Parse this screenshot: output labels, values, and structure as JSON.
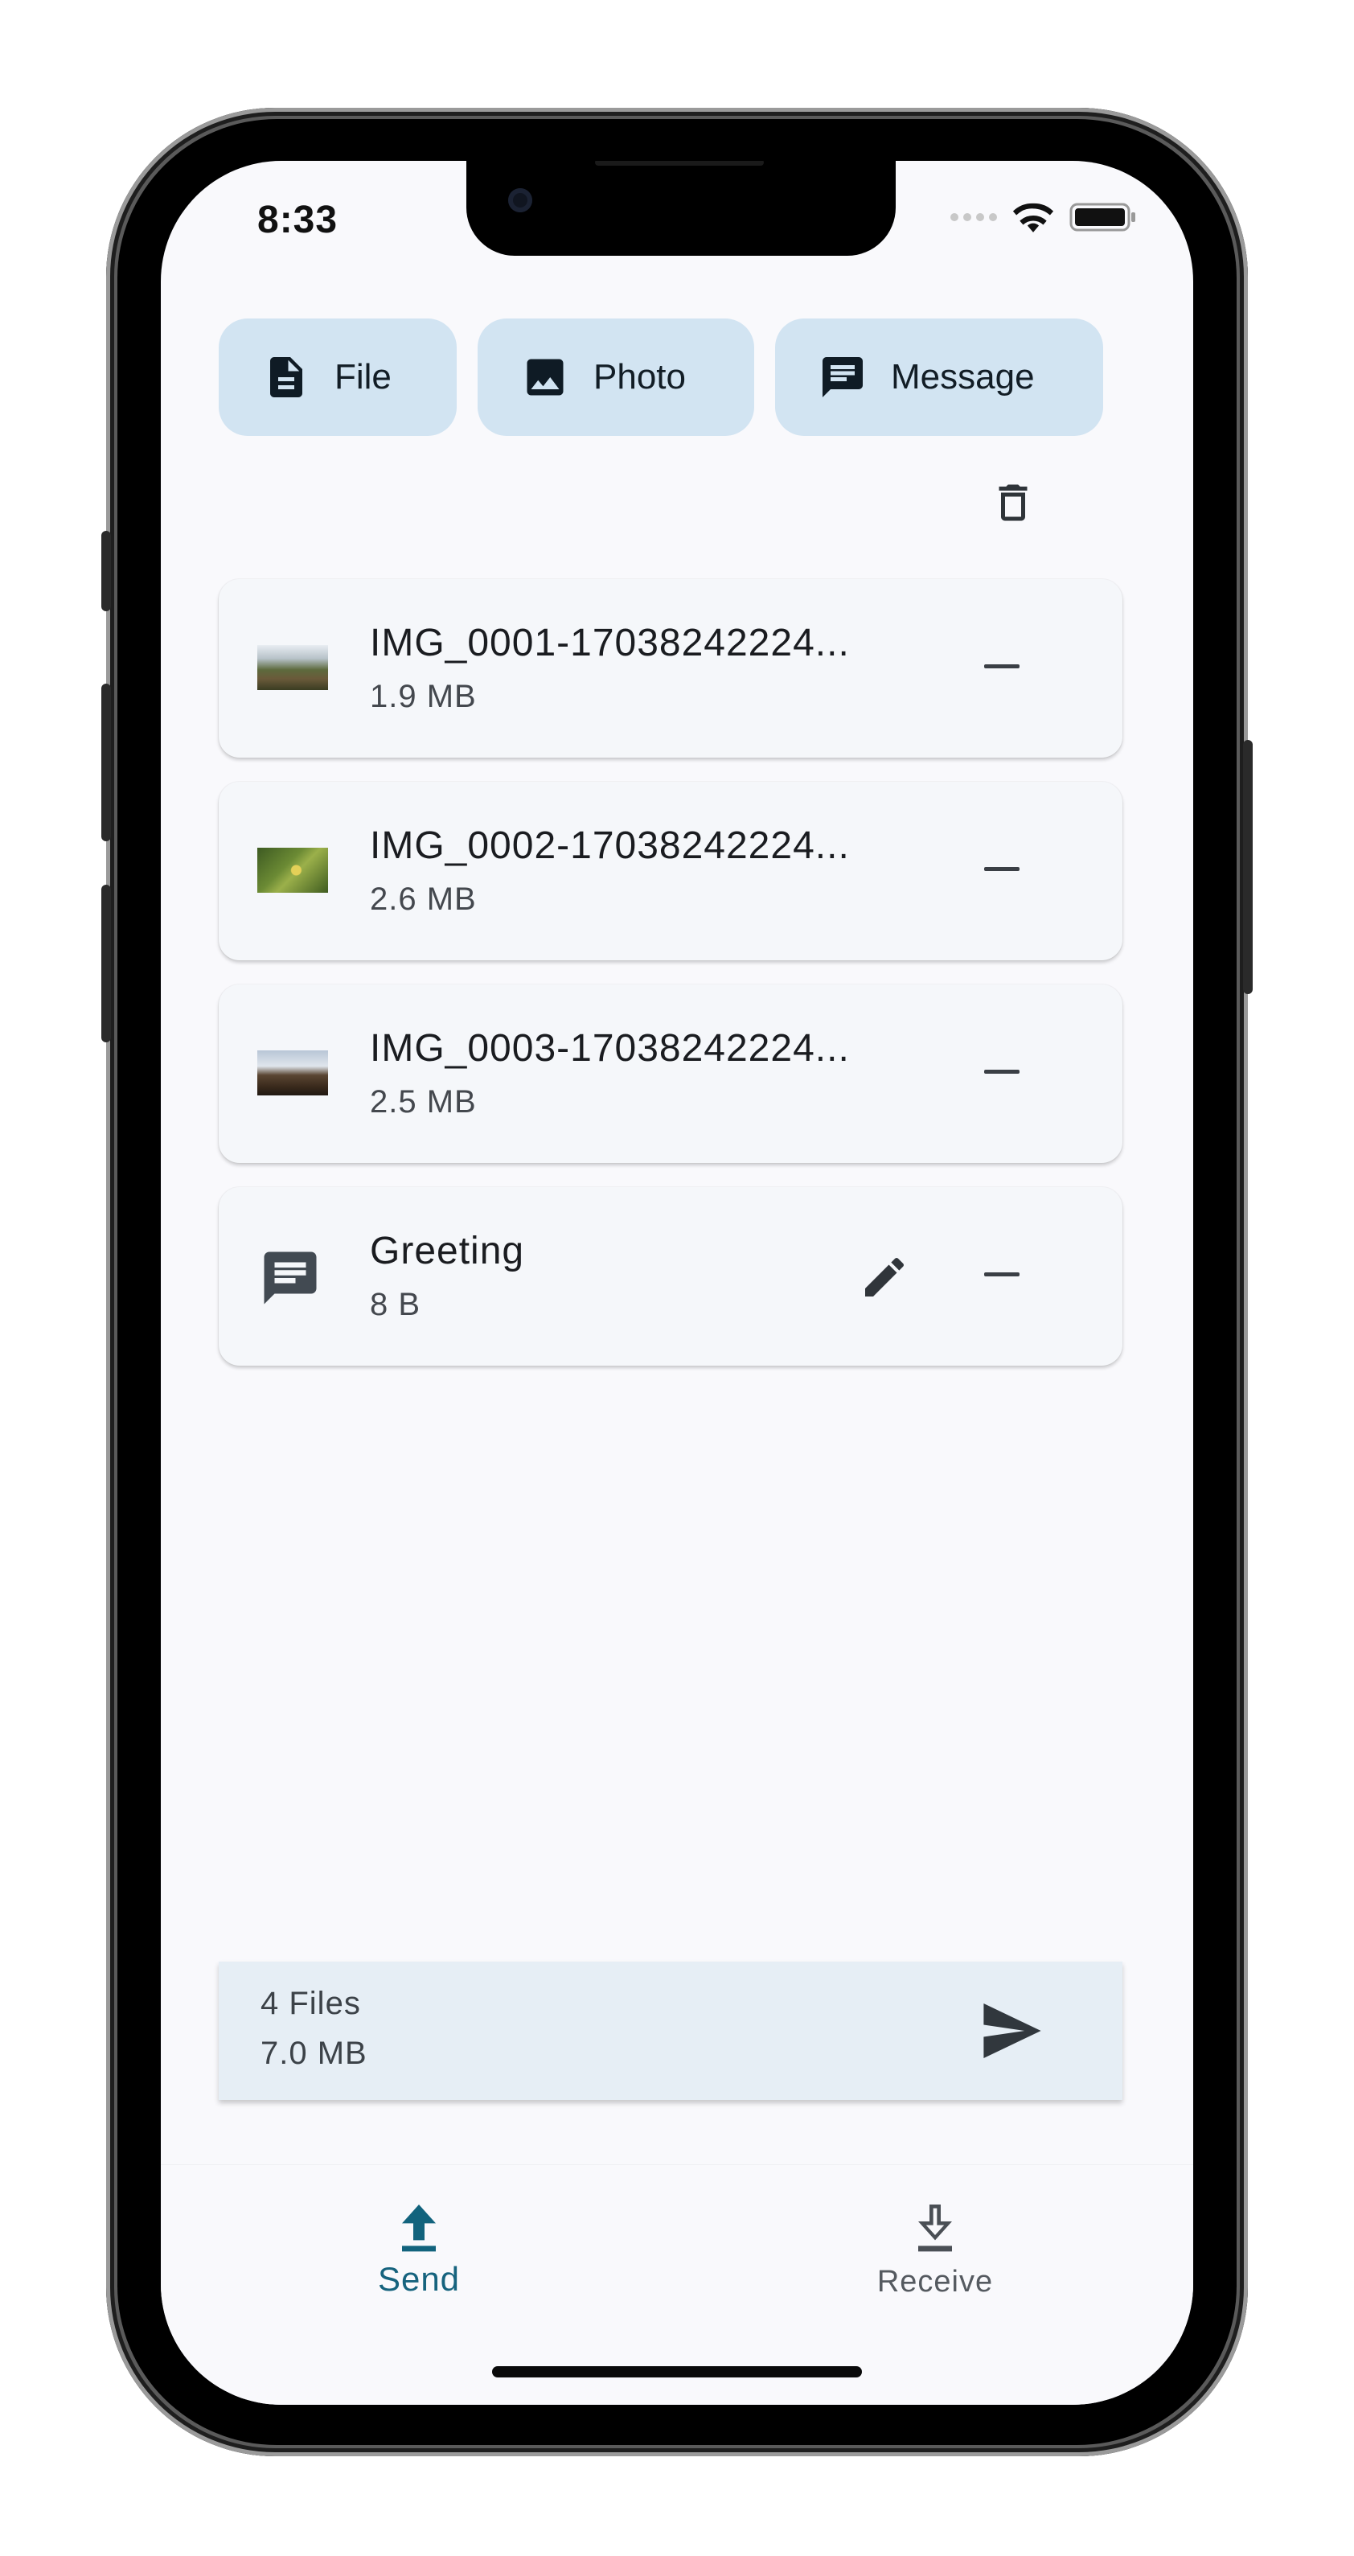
{
  "status_bar": {
    "time": "8:33"
  },
  "actions": [
    {
      "label": "File",
      "icon": "file-icon"
    },
    {
      "label": "Photo",
      "icon": "photo-icon"
    },
    {
      "label": "Message",
      "icon": "message-icon"
    }
  ],
  "items": [
    {
      "title": "IMG_0001-17038242224...",
      "size": "1.9 MB",
      "icon": "image-thumbnail"
    },
    {
      "title": "IMG_0002-17038242224...",
      "size": "2.6 MB",
      "icon": "image-thumbnail"
    },
    {
      "title": "IMG_0003-17038242224...",
      "size": "2.5 MB",
      "icon": "image-thumbnail"
    },
    {
      "title": "Greeting",
      "size": "8 B",
      "icon": "message-icon"
    }
  ],
  "summary": {
    "count": "4 Files",
    "size": "7.0 MB"
  },
  "nav": {
    "send": "Send",
    "receive": "Receive"
  },
  "colors": {
    "accent": "#12637d",
    "chip_bg": "#d2e4f2",
    "summary_bg": "#e6eef5"
  }
}
